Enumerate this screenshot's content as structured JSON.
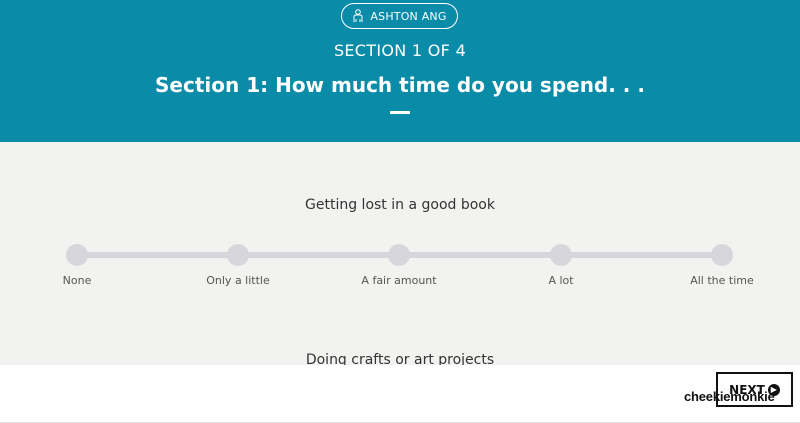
{
  "header": {
    "user_name": "ASHTON ANG",
    "user_icon": "person-icon",
    "section_count": "SECTION 1 OF 4",
    "section_title": "Section 1: How much time do you spend. . ."
  },
  "questions": [
    {
      "text": "Getting lost in a good book"
    },
    {
      "text": "Doing crafts or art projects"
    }
  ],
  "scale": {
    "options": [
      "None",
      "Only a little",
      "A fair amount",
      "A lot",
      "All the time"
    ],
    "selected": null
  },
  "footer": {
    "next_label": "NEXT",
    "next_icon": "chevron-right-circle-icon",
    "watermark": "cheekiemonkie"
  },
  "colors": {
    "header_bg": "#0a8ba8",
    "body_bg": "#f2f2f0",
    "slider": "#d6d6dc"
  }
}
